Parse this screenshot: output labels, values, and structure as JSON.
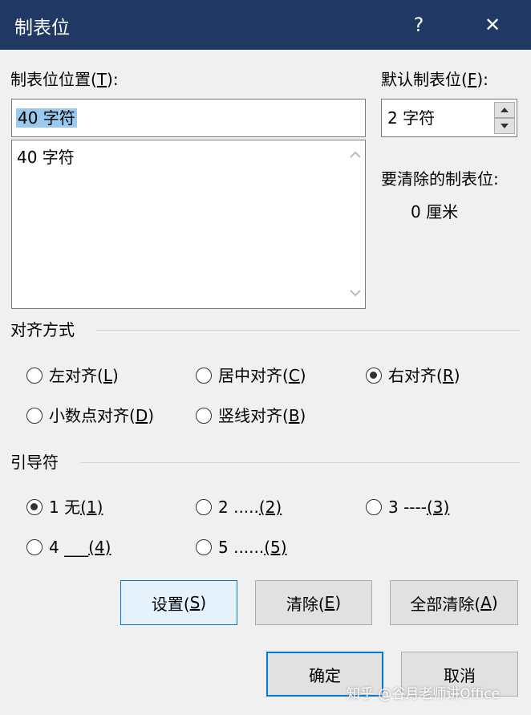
{
  "window": {
    "title": "制表位",
    "help": "?",
    "close": "✕"
  },
  "tab_position": {
    "label_prefix": "制表位位置(",
    "label_key": "T",
    "label_suffix": "):",
    "value": "40 字符",
    "list_items": [
      "40 字符"
    ]
  },
  "default_tab": {
    "label_prefix": "默认制表位(",
    "label_key": "F",
    "label_suffix": "):",
    "value": "2 字符"
  },
  "to_clear": {
    "label": "要清除的制表位:",
    "value": "0 厘米"
  },
  "alignment": {
    "title": "对齐方式",
    "options": [
      {
        "prefix": "左对齐(",
        "key": "L",
        "suffix": ")",
        "checked": false
      },
      {
        "prefix": "居中对齐(",
        "key": "C",
        "suffix": ")",
        "checked": false
      },
      {
        "prefix": "右对齐(",
        "key": "R",
        "suffix": ")",
        "checked": true
      },
      {
        "prefix": "小数点对齐(",
        "key": "D",
        "suffix": ")",
        "checked": false
      },
      {
        "prefix": "竖线对齐(",
        "key": "B",
        "suffix": ")",
        "checked": false
      }
    ]
  },
  "leader": {
    "title": "引导符",
    "options": [
      {
        "prefix": "1 无",
        "key": "(1)",
        "checked": true
      },
      {
        "prefix": "2 .....",
        "key": "(2)",
        "checked": false
      },
      {
        "prefix": "3 ----",
        "key": "(3)",
        "checked": false
      },
      {
        "prefix": "4 ___",
        "key": "(4)",
        "checked": false
      },
      {
        "prefix": "5 ......",
        "key": "(5)",
        "checked": false
      }
    ]
  },
  "buttons": {
    "set": {
      "prefix": "设置(",
      "key": "S",
      "suffix": ")"
    },
    "clear": {
      "prefix": "清除(",
      "key": "E",
      "suffix": ")"
    },
    "clear_all": {
      "prefix": "全部清除(",
      "key": "A",
      "suffix": ")"
    },
    "ok": "确定",
    "cancel": "取消"
  },
  "watermark": "知乎 @谷月老师讲Office"
}
